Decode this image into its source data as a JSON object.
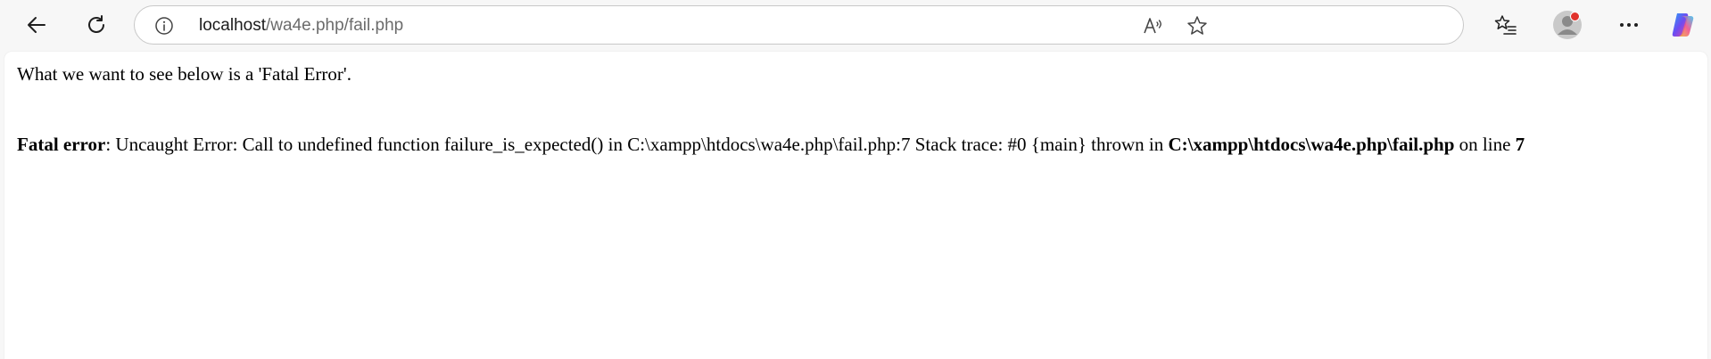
{
  "browser": {
    "url_host": "localhost",
    "url_path": "/wa4e.php/fail.php",
    "icons": {
      "back": "back-arrow-icon",
      "refresh": "refresh-icon",
      "site_info": "info-icon",
      "read_aloud": "read-aloud-icon",
      "favorite": "star-icon",
      "favorites_list": "favorites-icon",
      "profile": "profile-avatar-icon",
      "more": "more-icon",
      "copilot": "copilot-icon"
    },
    "accent": "#e0322c"
  },
  "page": {
    "intro": "What we want to see below is a 'Fatal Error'.",
    "error_label": "Fatal error",
    "error_message": ": Uncaught Error: Call to undefined function failure_is_expected() in C:\\xampp\\htdocs\\wa4e.php\\fail.php:7 Stack trace: #0 {main} thrown in ",
    "error_file": "C:\\xampp\\htdocs\\wa4e.php\\fail.php",
    "error_on_line": " on line ",
    "error_line": "7"
  }
}
